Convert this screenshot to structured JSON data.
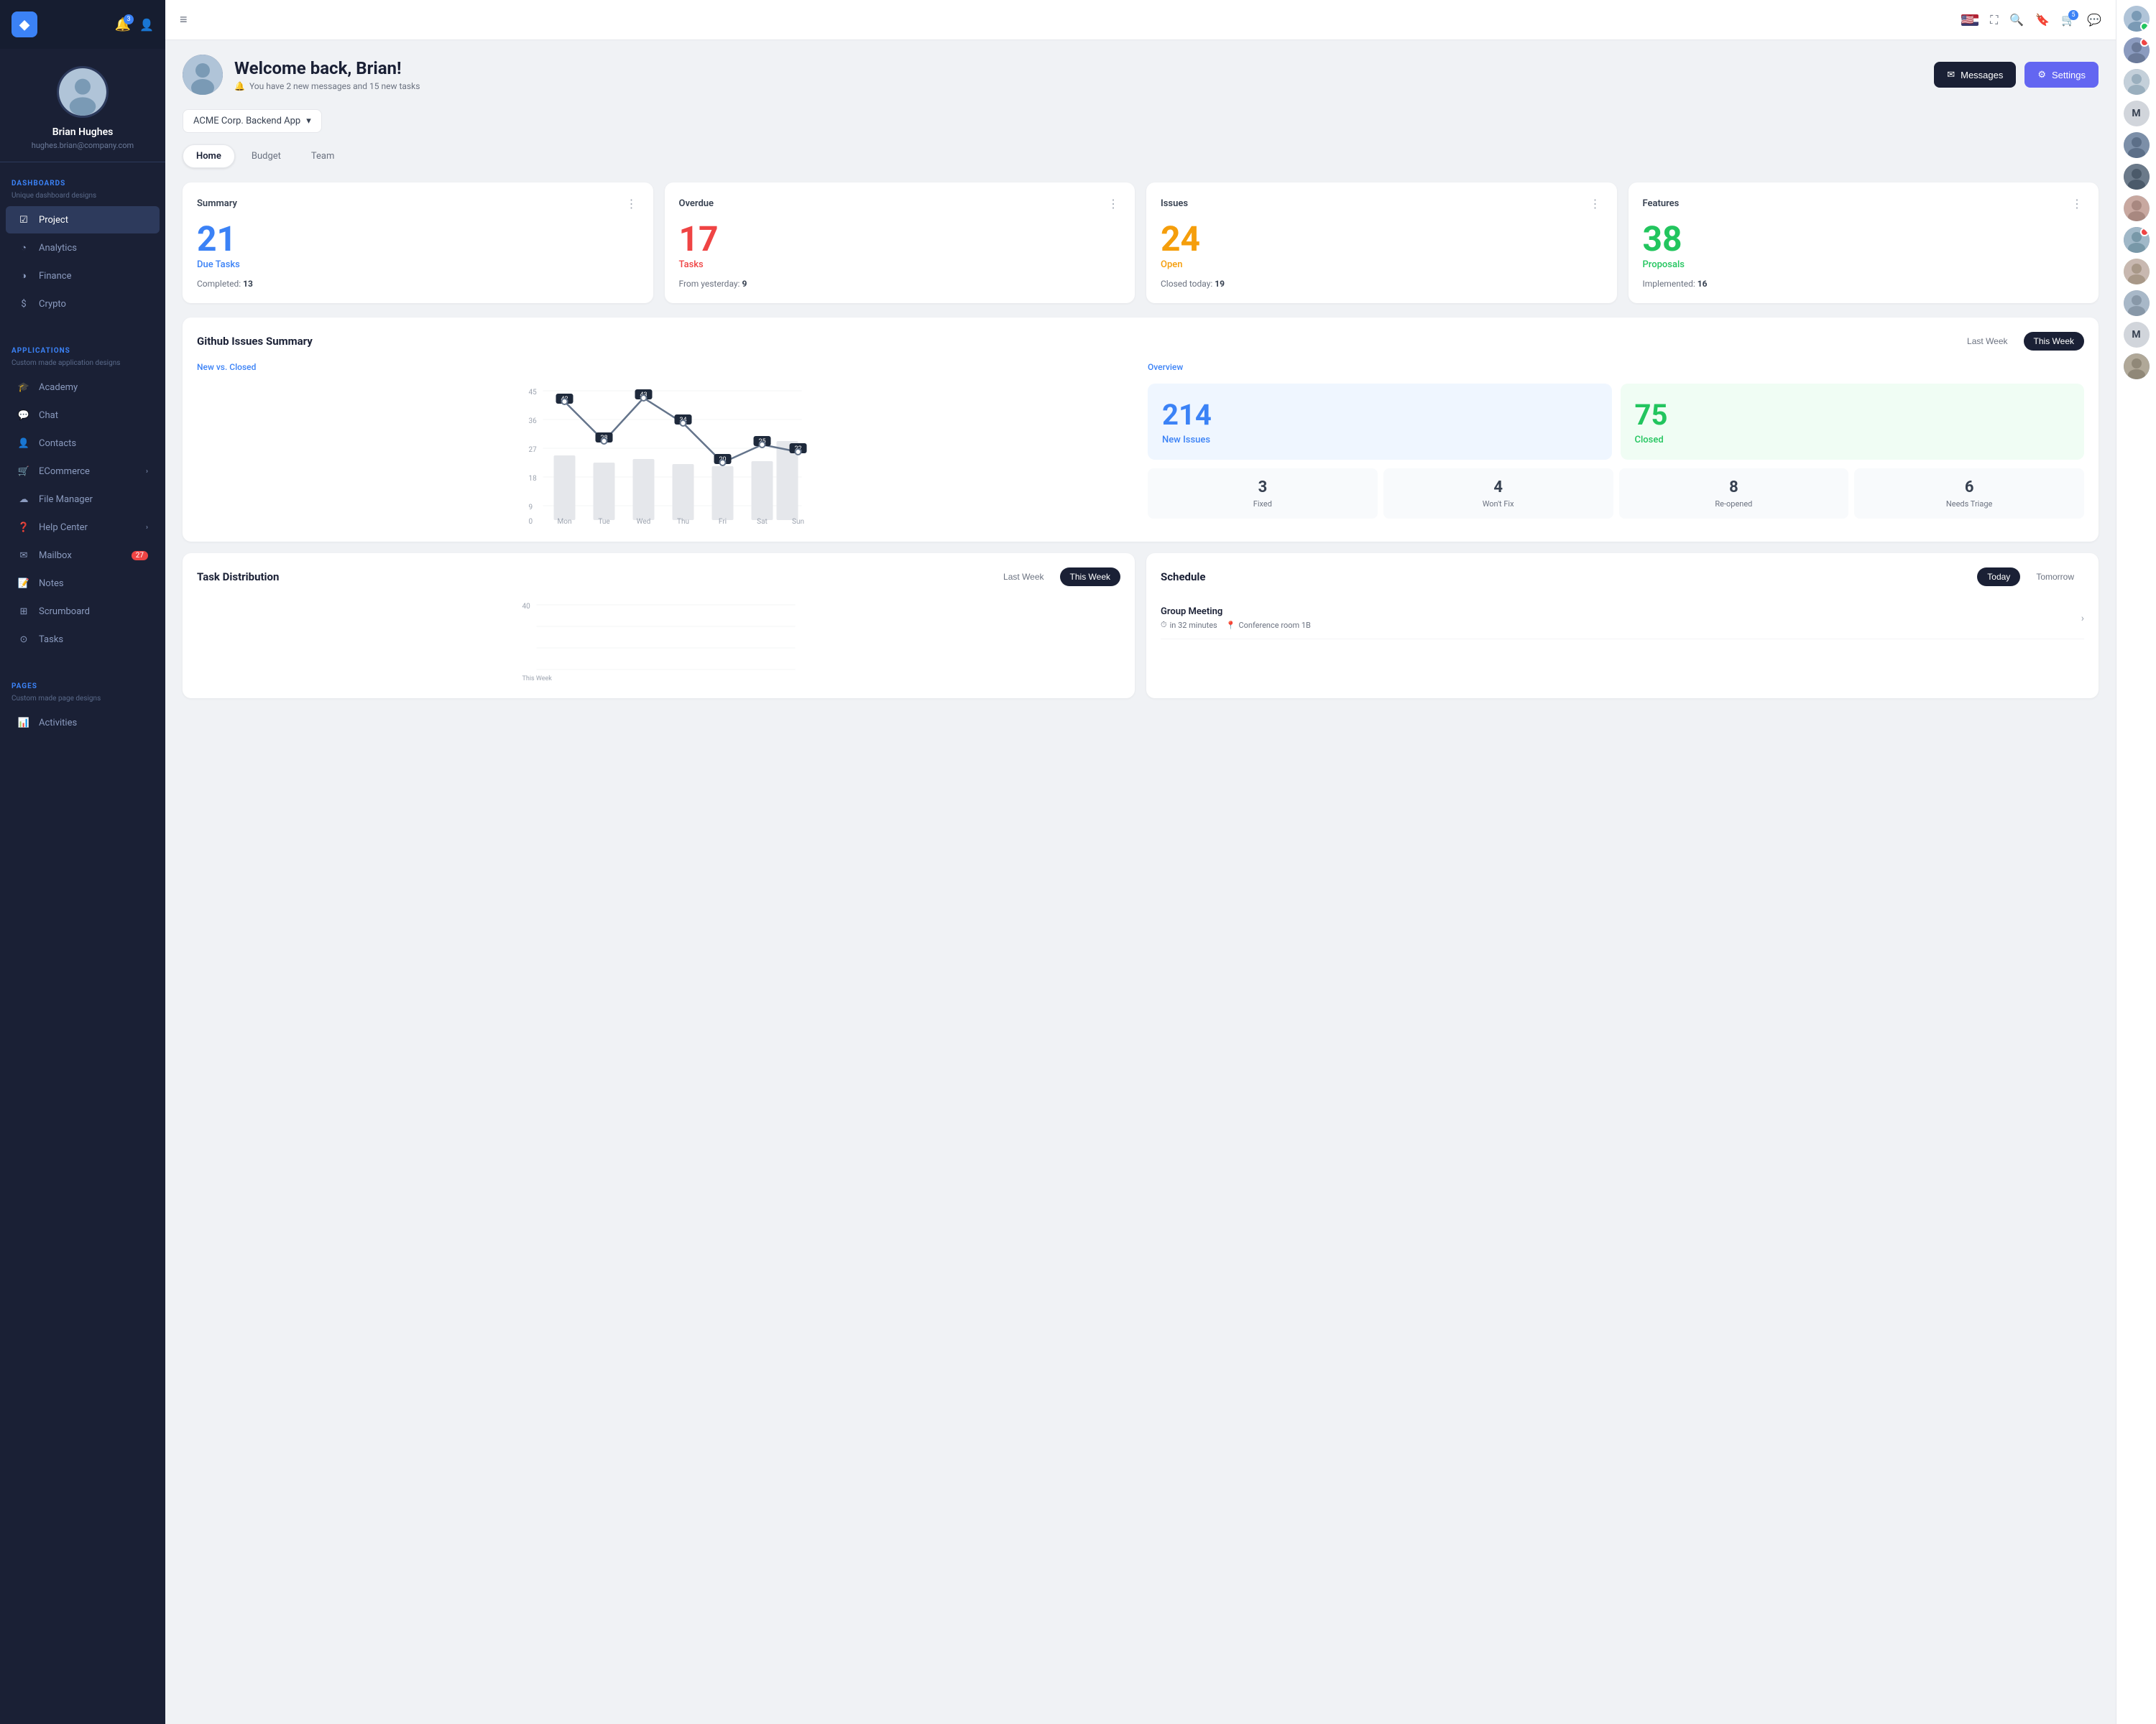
{
  "sidebar": {
    "logo": "◆",
    "user": {
      "name": "Brian Hughes",
      "email": "hughes.brian@company.com"
    },
    "notifications_count": "3",
    "sections": [
      {
        "label": "DASHBOARDS",
        "sub": "Unique dashboard designs",
        "items": [
          {
            "id": "project",
            "label": "Project",
            "icon": "☑",
            "active": true
          },
          {
            "id": "analytics",
            "label": "Analytics",
            "icon": "◔"
          },
          {
            "id": "finance",
            "label": "Finance",
            "icon": "◑"
          },
          {
            "id": "crypto",
            "label": "Crypto",
            "icon": "$"
          }
        ]
      },
      {
        "label": "APPLICATIONS",
        "sub": "Custom made application designs",
        "items": [
          {
            "id": "academy",
            "label": "Academy",
            "icon": "🎓"
          },
          {
            "id": "chat",
            "label": "Chat",
            "icon": "💬"
          },
          {
            "id": "contacts",
            "label": "Contacts",
            "icon": "👤"
          },
          {
            "id": "ecommerce",
            "label": "ECommerce",
            "icon": "🛒",
            "arrow": true
          },
          {
            "id": "filemanager",
            "label": "File Manager",
            "icon": "☁"
          },
          {
            "id": "helpcenter",
            "label": "Help Center",
            "icon": "❓",
            "arrow": true
          },
          {
            "id": "mailbox",
            "label": "Mailbox",
            "icon": "✉",
            "badge": "27"
          },
          {
            "id": "notes",
            "label": "Notes",
            "icon": "📝"
          },
          {
            "id": "scrumboard",
            "label": "Scrumboard",
            "icon": "⊞"
          },
          {
            "id": "tasks",
            "label": "Tasks",
            "icon": "⊙"
          }
        ]
      },
      {
        "label": "PAGES",
        "sub": "Custom made page designs",
        "items": [
          {
            "id": "activities",
            "label": "Activities",
            "icon": "📊"
          }
        ]
      }
    ]
  },
  "topbar": {
    "menu_icon": "≡",
    "flag": "🇺🇸",
    "search_icon": "🔍",
    "bookmark_icon": "🔖",
    "cart_icon": "🛒",
    "cart_badge": "5",
    "chat_icon": "💬"
  },
  "welcome": {
    "greeting": "Welcome back, Brian!",
    "subtitle": "You have 2 new messages and 15 new tasks",
    "messages_btn": "Messages",
    "settings_btn": "Settings"
  },
  "project_selector": {
    "label": "ACME Corp. Backend App"
  },
  "tabs": [
    {
      "id": "home",
      "label": "Home",
      "active": true
    },
    {
      "id": "budget",
      "label": "Budget"
    },
    {
      "id": "team",
      "label": "Team"
    }
  ],
  "summary_cards": [
    {
      "title": "Summary",
      "number": "21",
      "label": "Due Tasks",
      "color": "blue",
      "detail_label": "Completed:",
      "detail_value": "13"
    },
    {
      "title": "Overdue",
      "number": "17",
      "label": "Tasks",
      "color": "red",
      "detail_label": "From yesterday:",
      "detail_value": "9"
    },
    {
      "title": "Issues",
      "number": "24",
      "label": "Open",
      "color": "orange",
      "detail_label": "Closed today:",
      "detail_value": "19"
    },
    {
      "title": "Features",
      "number": "38",
      "label": "Proposals",
      "color": "green",
      "detail_label": "Implemented:",
      "detail_value": "16"
    }
  ],
  "github": {
    "title": "Github Issues Summary",
    "last_week_btn": "Last Week",
    "this_week_btn": "This Week",
    "chart_label": "New vs. Closed",
    "overview_label": "Overview",
    "chart_data": {
      "days": [
        "Mon",
        "Tue",
        "Wed",
        "Thu",
        "Fri",
        "Sat",
        "Sun"
      ],
      "line_values": [
        42,
        28,
        43,
        34,
        20,
        25,
        22
      ],
      "bar_values": [
        30,
        25,
        20,
        22,
        18,
        28,
        38
      ]
    },
    "new_issues": "214",
    "new_issues_label": "New Issues",
    "closed": "75",
    "closed_label": "Closed",
    "mini_stats": [
      {
        "num": "3",
        "label": "Fixed"
      },
      {
        "num": "4",
        "label": "Won't Fix"
      },
      {
        "num": "8",
        "label": "Re-opened"
      },
      {
        "num": "6",
        "label": "Needs Triage"
      }
    ]
  },
  "task_distribution": {
    "title": "Task Distribution",
    "last_week_btn": "Last Week",
    "this_week_btn": "This Week"
  },
  "schedule": {
    "title": "Schedule",
    "today_btn": "Today",
    "tomorrow_btn": "Tomorrow",
    "items": [
      {
        "title": "Group Meeting",
        "time": "in 32 minutes",
        "location": "Conference room 1B"
      }
    ]
  },
  "right_sidebar": {
    "avatars": [
      {
        "initials": "",
        "color": "#9ca3af",
        "status": "online"
      },
      {
        "initials": "",
        "color": "#6b7280",
        "status": "notification"
      },
      {
        "initials": "",
        "color": "#8b9bbf",
        "status": ""
      },
      {
        "initials": "M",
        "color": "#d1d5db",
        "status": ""
      },
      {
        "initials": "",
        "color": "#5a6a8a",
        "status": ""
      },
      {
        "initials": "",
        "color": "#4b5563",
        "status": ""
      },
      {
        "initials": "",
        "color": "#7c8fa8",
        "status": ""
      },
      {
        "initials": "",
        "color": "#6b7a99",
        "status": "notification"
      },
      {
        "initials": "",
        "color": "#8b9bbf",
        "status": ""
      },
      {
        "initials": "",
        "color": "#9ca3af",
        "status": ""
      },
      {
        "initials": "M",
        "color": "#d1d5db",
        "status": ""
      },
      {
        "initials": "",
        "color": "#6b7280",
        "status": ""
      }
    ]
  }
}
